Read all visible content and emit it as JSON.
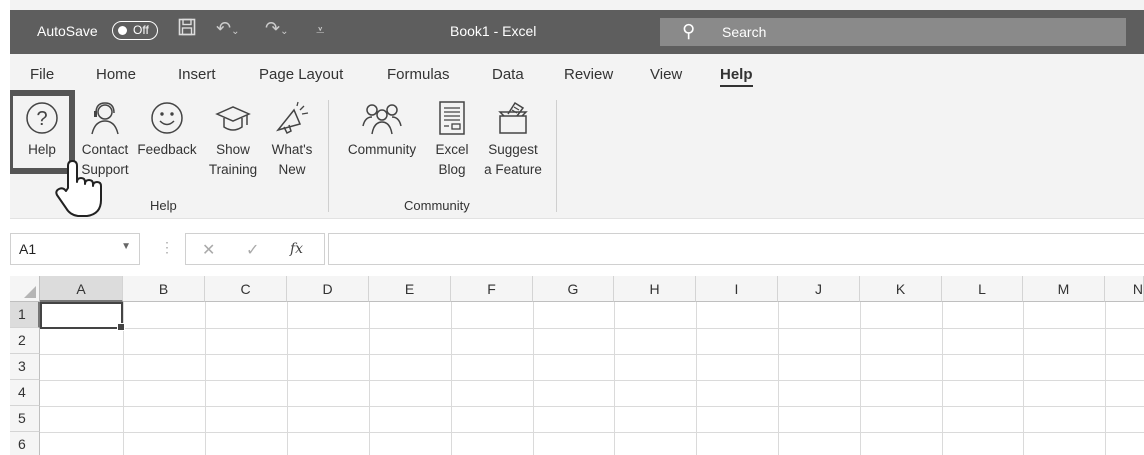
{
  "titlebar": {
    "autosave_label": "AutoSave",
    "autosave_state": "Off",
    "doc_title": "Book1  -  Excel",
    "search_placeholder": "Search"
  },
  "menu": {
    "items": [
      "File",
      "Home",
      "Insert",
      "Page Layout",
      "Formulas",
      "Data",
      "Review",
      "View",
      "Help"
    ],
    "active": "Help"
  },
  "ribbon": {
    "help_group": {
      "label": "Help",
      "buttons": [
        {
          "line1": "Help",
          "line2": "",
          "icon": "question-circle-icon"
        },
        {
          "line1": "Contact",
          "line2": "Support",
          "icon": "headset-person-icon"
        },
        {
          "line1": "Feedback",
          "line2": "",
          "icon": "smiley-icon"
        },
        {
          "line1": "Show",
          "line2": "Training",
          "icon": "graduation-cap-icon"
        },
        {
          "line1": "What's",
          "line2": "New",
          "icon": "megaphone-icon"
        }
      ]
    },
    "community_group": {
      "label": "Community",
      "buttons": [
        {
          "line1": "Community",
          "line2": "",
          "icon": "people-icon"
        },
        {
          "line1": "Excel",
          "line2": "Blog",
          "icon": "blog-document-icon"
        },
        {
          "line1": "Suggest",
          "line2": "a Feature",
          "icon": "suggestion-box-icon"
        }
      ]
    }
  },
  "formula_bar": {
    "name_box": "A1",
    "fx_label": "fx",
    "formula": ""
  },
  "sheet": {
    "columns": [
      "A",
      "B",
      "C",
      "D",
      "E",
      "F",
      "G",
      "H",
      "I",
      "J",
      "K",
      "L",
      "M",
      "N"
    ],
    "rows": [
      "1",
      "2",
      "3",
      "4",
      "5",
      "6"
    ],
    "active_cell": "A1"
  }
}
